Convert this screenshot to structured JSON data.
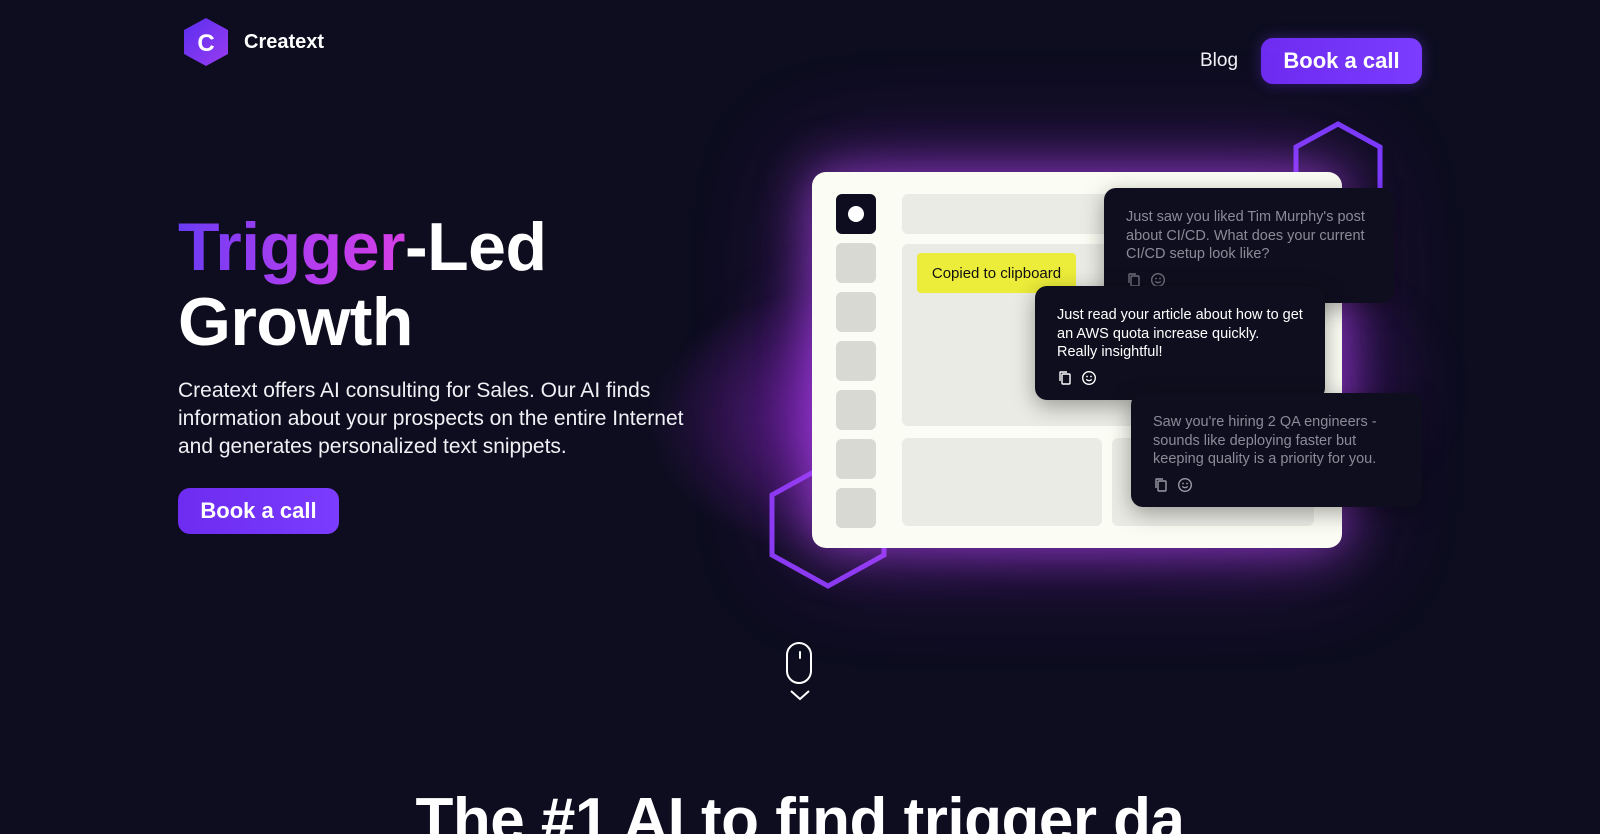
{
  "brand": {
    "logo_letter": "C",
    "name": "Creatext"
  },
  "nav": {
    "blog_label": "Blog",
    "cta_label": "Book a call"
  },
  "hero": {
    "title_highlight": "Trigger",
    "title_rest_line1": "-Led",
    "title_line2": "Growth",
    "description": "Creatext offers AI consulting for Sales. Our AI finds information about your prospects on the entire Internet and generates personalized text snippets.",
    "cta_label": "Book a call"
  },
  "mockup": {
    "toast": "Copied to clipboard",
    "cards": [
      {
        "text": "Just saw you liked Tim Murphy's post about CI/CD. What does your current CI/CD setup look like?"
      },
      {
        "text": "Just read your article about how to get an AWS quota increase quickly. Really insightful!"
      },
      {
        "text": "Saw you're hiring 2 QA engineers - sounds like deploying faster but keeping quality is a priority for you."
      }
    ]
  },
  "next_section": {
    "title": "The #1 AI to find trigger da"
  },
  "colors": {
    "background": "#0d0d1f",
    "accent": "#7b3cff",
    "toast": "#ecec3a",
    "gradient_start": "#6a3cf5",
    "gradient_end": "#d63fe6"
  },
  "icons": [
    "logo-hex-icon",
    "copy-icon",
    "smiley-icon",
    "mouse-scroll-icon",
    "chevron-down-icon"
  ]
}
